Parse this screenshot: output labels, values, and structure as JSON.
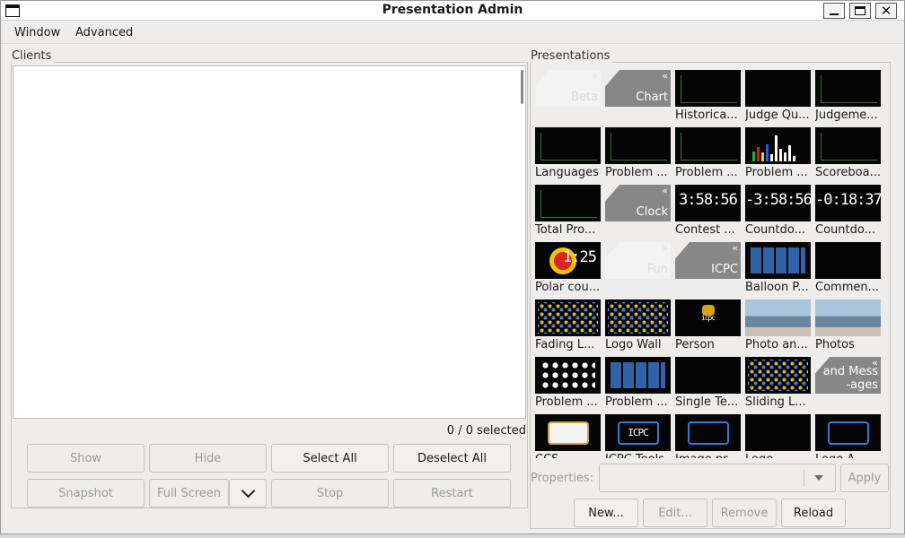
{
  "window": {
    "title": "Presentation Admin"
  },
  "titlebar_buttons": {
    "minimize_icon": "window-minimize-icon",
    "maximize_icon": "window-maximize-icon",
    "close_icon": "window-close-icon"
  },
  "menu": [
    "Window",
    "Advanced"
  ],
  "clients": {
    "group_label": "Clients",
    "selected_count": "0 / 0 selected",
    "buttons": {
      "show": "Show",
      "hide": "Hide",
      "select_all": "Select All",
      "deselect_all": "Deselect All",
      "snapshot": "Snapshot",
      "full_screen": "Full Screen",
      "stop": "Stop",
      "restart": "Restart"
    }
  },
  "presentations": {
    "group_label": "Presentations",
    "tiles": [
      {
        "label": "",
        "thumb_text": "Beta",
        "fold": "»",
        "kind": "category-light"
      },
      {
        "label": "",
        "thumb_text": "Chart",
        "fold": "«",
        "kind": "category-gray"
      },
      {
        "label": "Historica...",
        "kind": "chart"
      },
      {
        "label": "Judge Qu...",
        "kind": "black"
      },
      {
        "label": "Judgeme...",
        "kind": "chart"
      },
      {
        "label": "Languages",
        "kind": "chart"
      },
      {
        "label": "Problem ...",
        "kind": "chart"
      },
      {
        "label": "Problem ...",
        "kind": "chart"
      },
      {
        "label": "Problem ...",
        "kind": "bars"
      },
      {
        "label": "Scoreboa...",
        "kind": "chart"
      },
      {
        "label": "Total Pro...",
        "kind": "chart"
      },
      {
        "label": "",
        "thumb_text": "Clock",
        "fold": "«",
        "kind": "category-gray"
      },
      {
        "label": "Contest ...",
        "thumb_text": "3:58:56",
        "kind": "clock"
      },
      {
        "label": "Countdo...",
        "thumb_text": "-3:58:56",
        "kind": "clock"
      },
      {
        "label": "Countdo...",
        "thumb_text": "-0:18:37",
        "kind": "clock"
      },
      {
        "label": "Polar cou...",
        "thumb_text": "1:25",
        "kind": "polar"
      },
      {
        "label": "",
        "thumb_text": "Fun",
        "fold": "»",
        "kind": "category-light"
      },
      {
        "label": "",
        "thumb_text": "ICPC",
        "fold": "«",
        "kind": "category-gray"
      },
      {
        "label": "Balloon P...",
        "kind": "blocks"
      },
      {
        "label": "Commen...",
        "kind": "black"
      },
      {
        "label": "Fading L...",
        "kind": "dots"
      },
      {
        "label": "Logo Wall",
        "kind": "dots"
      },
      {
        "label": "Person",
        "thumb_text": "icpc",
        "kind": "person"
      },
      {
        "label": "Photo an...",
        "kind": "photo"
      },
      {
        "label": "Photos",
        "kind": "photo"
      },
      {
        "label": "Problem ...",
        "kind": "circles"
      },
      {
        "label": "Problem ...",
        "kind": "blocks"
      },
      {
        "label": "Single Te...",
        "kind": "black"
      },
      {
        "label": "Sliding L...",
        "kind": "dots"
      },
      {
        "label": "",
        "thumb_text": "and Mess\n-ages",
        "fold": "«",
        "kind": "category-gray"
      },
      {
        "label": "CCS ...",
        "kind": "ccs"
      },
      {
        "label": "ICPC Tools",
        "thumb_text": "ICPC",
        "kind": "logo"
      },
      {
        "label": "Image pr...",
        "kind": "logo"
      },
      {
        "label": "Logo",
        "kind": "black"
      },
      {
        "label": "Logo A...",
        "kind": "logo"
      }
    ]
  },
  "properties": {
    "label": "Properties:",
    "apply": "Apply",
    "dropdown_icon": "chevron-down-icon"
  },
  "bottom_buttons": {
    "new": "New...",
    "edit": "Edit...",
    "remove": "Remove",
    "reload": "Reload"
  }
}
